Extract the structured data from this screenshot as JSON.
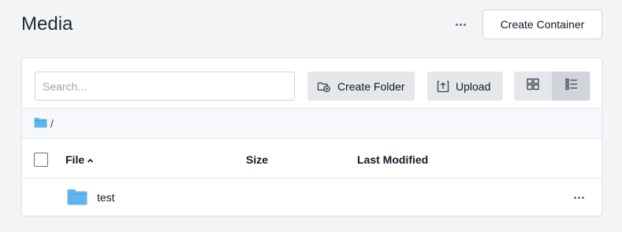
{
  "header": {
    "title": "Media",
    "more_icon": "ellipsis-icon",
    "create_container_label": "Create Container"
  },
  "toolbar": {
    "search_placeholder": "Search...",
    "search_value": "",
    "create_folder_label": "Create Folder",
    "upload_label": "Upload",
    "view_modes": [
      "grid",
      "list"
    ],
    "active_view": "list"
  },
  "breadcrumb": {
    "path_separator": "/"
  },
  "table": {
    "columns": {
      "file": "File",
      "size": "Size",
      "last_modified": "Last Modified"
    },
    "sort_indicator": "ascending",
    "rows": [
      {
        "name": "test",
        "type": "folder",
        "size": "",
        "last_modified": ""
      }
    ]
  },
  "colors": {
    "folder": "#60b4f0",
    "button_bg": "#e5e7eb",
    "page_bg": "#f3f4f6"
  }
}
